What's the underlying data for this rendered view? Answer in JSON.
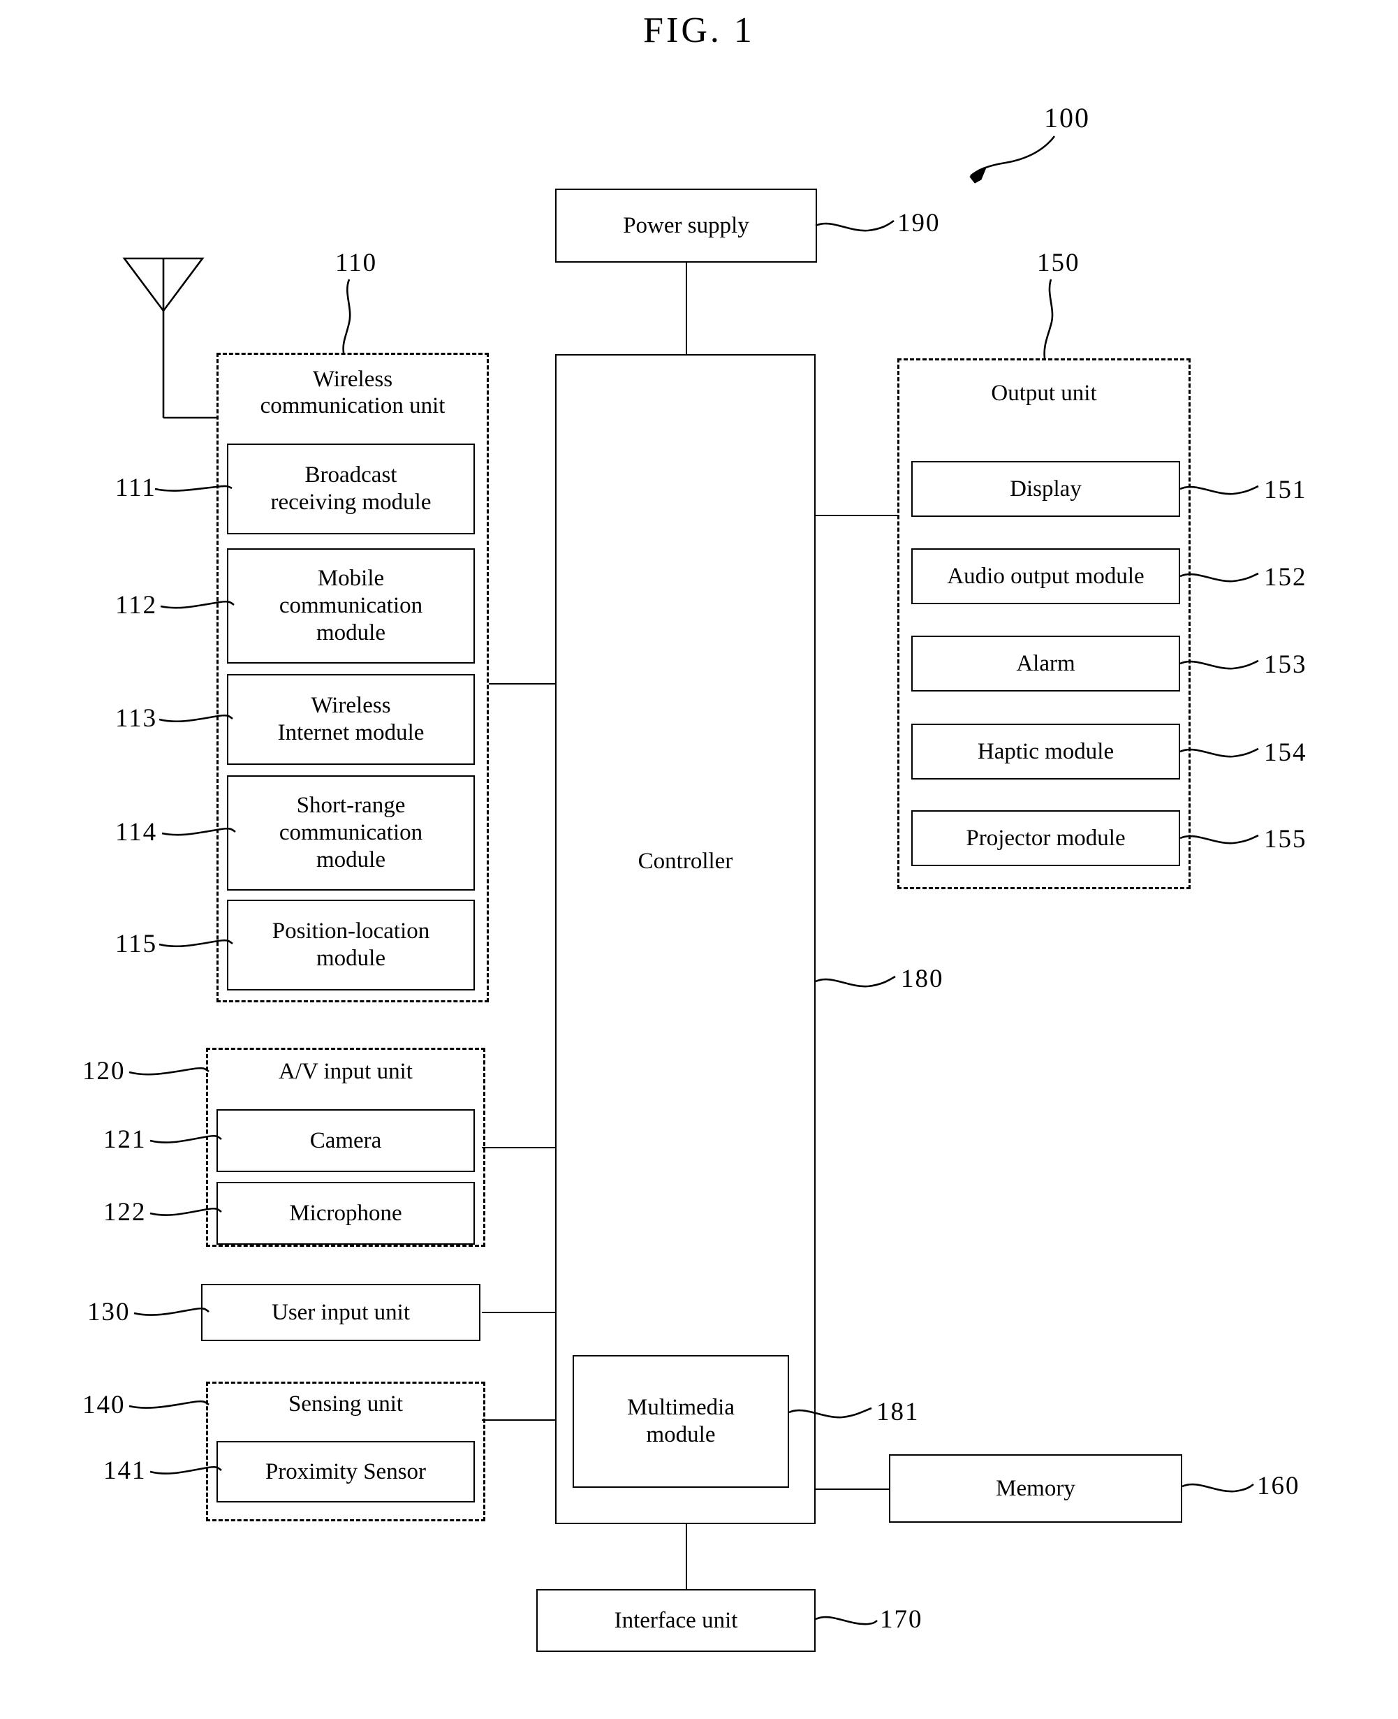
{
  "figure": {
    "title": "FIG. 1",
    "device_ref": "100"
  },
  "power_supply": {
    "label": "Power supply",
    "ref": "190"
  },
  "controller": {
    "label": "Controller",
    "ref": "180",
    "multimedia_module": {
      "label": "Multimedia\nmodule",
      "label_line1": "Multimedia",
      "label_line2": "module",
      "ref": "181"
    }
  },
  "wireless_communication_unit": {
    "title_line1": "Wireless",
    "title_line2": "communication unit",
    "ref": "110",
    "modules": [
      {
        "ref": "111",
        "line1": "Broadcast",
        "line2": "receiving module",
        "line3": ""
      },
      {
        "ref": "112",
        "line1": "Mobile",
        "line2": "communication",
        "line3": "module"
      },
      {
        "ref": "113",
        "line1": "Wireless",
        "line2": "Internet module",
        "line3": ""
      },
      {
        "ref": "114",
        "line1": "Short-range",
        "line2": "communication",
        "line3": "module"
      },
      {
        "ref": "115",
        "line1": "Position-location",
        "line2": "module",
        "line3": ""
      }
    ]
  },
  "av_input_unit": {
    "title": "A/V input unit",
    "ref": "120",
    "modules": [
      {
        "ref": "121",
        "label": "Camera"
      },
      {
        "ref": "122",
        "label": "Microphone"
      }
    ]
  },
  "user_input_unit": {
    "label": "User input unit",
    "ref": "130"
  },
  "sensing_unit": {
    "title": "Sensing unit",
    "ref": "140",
    "modules": [
      {
        "ref": "141",
        "label": "Proximity Sensor"
      }
    ]
  },
  "output_unit": {
    "title": "Output unit",
    "ref": "150",
    "modules": [
      {
        "ref": "151",
        "label": "Display"
      },
      {
        "ref": "152",
        "label": "Audio output module"
      },
      {
        "ref": "153",
        "label": "Alarm"
      },
      {
        "ref": "154",
        "label": "Haptic module"
      },
      {
        "ref": "155",
        "label": "Projector module"
      }
    ]
  },
  "memory": {
    "label": "Memory",
    "ref": "160"
  },
  "interface_unit": {
    "label": "Interface unit",
    "ref": "170"
  },
  "antenna": {
    "name": "antenna-symbol"
  }
}
